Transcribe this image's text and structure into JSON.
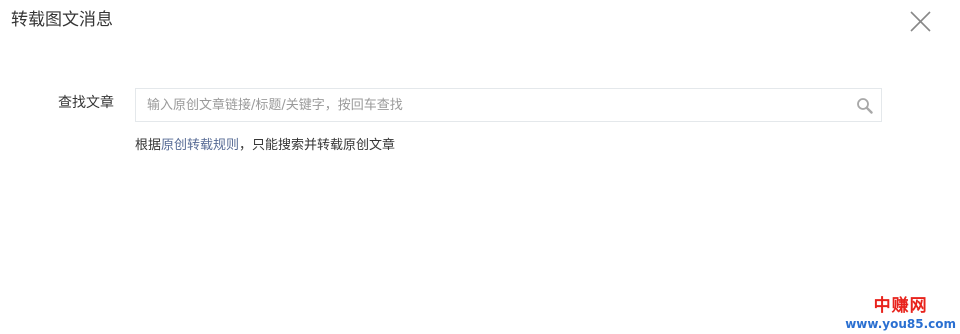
{
  "dialog": {
    "title": "转载图文消息",
    "close_icon": "close-icon"
  },
  "search": {
    "label": "查找文章",
    "placeholder": "输入原创文章链接/标题/关键字，按回车查找",
    "value": "",
    "icon": "search-icon"
  },
  "hint": {
    "prefix": "根据",
    "link_text": "原创转载规则",
    "suffix": "，只能搜索并转载原创文章",
    "link_color": "#576b95"
  },
  "watermark": {
    "name": "中赚网",
    "url": "www.you85.com"
  }
}
